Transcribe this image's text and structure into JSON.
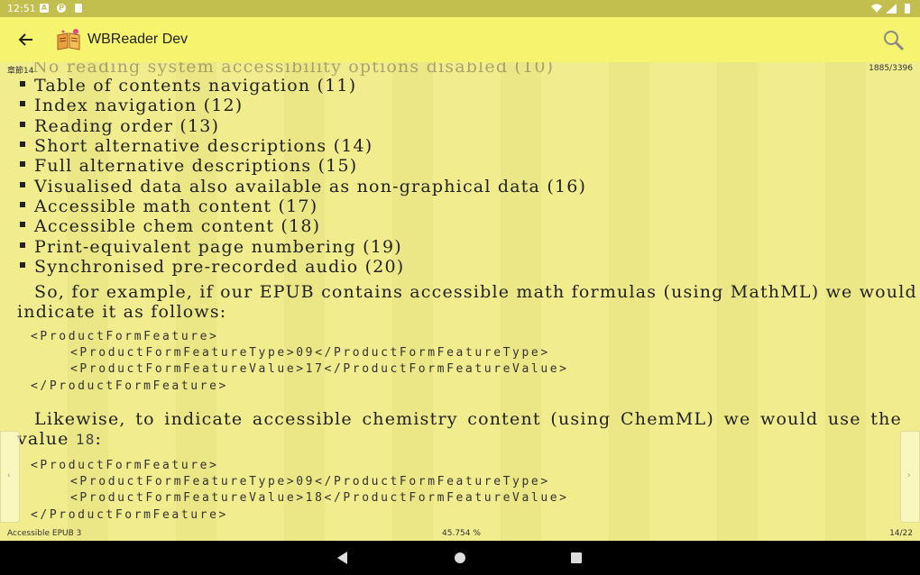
{
  "status_bar": {
    "time": "12:51",
    "left_icons": [
      "a-icon",
      "p-icon",
      "sd-card-icon"
    ],
    "right_icons": [
      "wifi-icon",
      "signal-icon",
      "battery-icon"
    ]
  },
  "app_bar": {
    "title": "WBReader Dev",
    "back_icon": "arrow-left-icon",
    "app_icon": "book-icon",
    "search_icon": "search-icon"
  },
  "reader": {
    "chapter_label": "章節14",
    "position": "1885/3396",
    "cut_line": "No reading system accessibility options disabled (10)",
    "bullets": [
      "Table of contents navigation (11)",
      "Index navigation (12)",
      "Reading order (13)",
      "Short alternative descriptions (14)",
      "Full alternative descriptions (15)",
      "Visualised data also available as non-graphical data (16)",
      "Accessible math content (17)",
      "Accessible chem content (18)",
      "Print-equivalent page numbering (19)",
      "Synchronised pre-recorded audio (20)"
    ],
    "para1_line1": "So, for example, if our EPUB contains accessible math formulas (using MathML) we would",
    "para1_line2": "indicate it as follows:",
    "code_block_1": [
      "<ProductFormFeature>",
      "<ProductFormFeatureType>09</ProductFormFeatureType>",
      "<ProductFormFeatureValue>17</ProductFormFeatureValue>",
      "</ProductFormFeature>"
    ],
    "para2_line1": "Likewise, to indicate accessible chemistry content (using ChemML) we would use the",
    "para2_line2_prefix": "value",
    "para2_code": "18",
    "para2_suffix": ":",
    "code_block_2": [
      "<ProductFormFeature>",
      "<ProductFormFeatureType>09</ProductFormFeatureType>",
      "<ProductFormFeatureValue>18</ProductFormFeatureValue>",
      "</ProductFormFeature>"
    ]
  },
  "footer": {
    "book_title": "Accessible EPUB 3",
    "progress": "45.754 %",
    "page": "14/22"
  },
  "nav_bar": {
    "icons": [
      "back-triangle-icon",
      "home-circle-icon",
      "recents-square-icon"
    ]
  }
}
